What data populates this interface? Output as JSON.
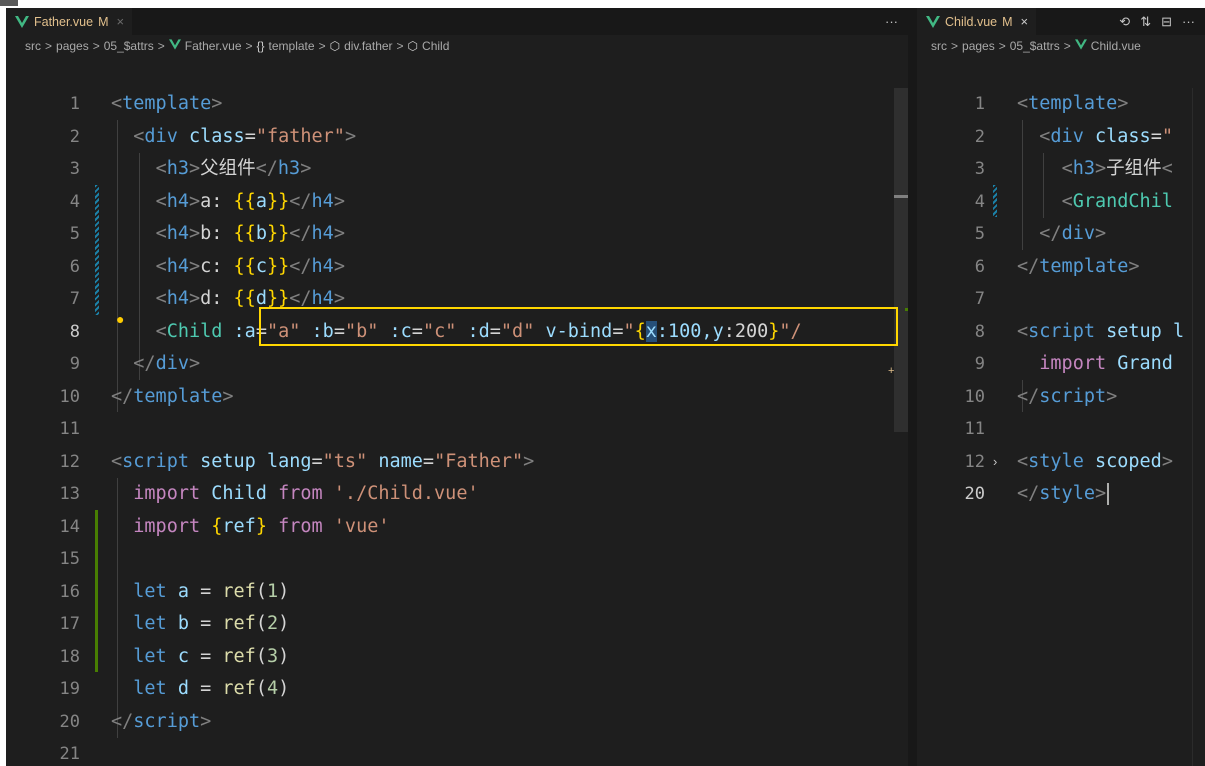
{
  "left_editor": {
    "tab": {
      "icon": "vue-icon",
      "name": "Father.vue",
      "status": "M",
      "close": "×"
    },
    "more_actions": "···",
    "breadcrumbs": [
      "src",
      "pages",
      "05_$attrs",
      "Father.vue",
      "template",
      "div.father",
      "Child"
    ],
    "breadcrumb_symbols": {
      "template": "{}",
      "div.father": "⬡",
      "Child": "⬡"
    },
    "lines": [
      {
        "n": "1",
        "segments": [
          [
            "pun",
            "<"
          ],
          [
            "tag",
            "template"
          ],
          [
            "pun",
            ">"
          ]
        ]
      },
      {
        "n": "2",
        "segments": [
          [
            "txt",
            "  "
          ],
          [
            "pun",
            "<"
          ],
          [
            "tag",
            "div"
          ],
          [
            "txt",
            " "
          ],
          [
            "attr",
            "class"
          ],
          [
            "txt",
            "="
          ],
          [
            "str",
            "\"father\""
          ],
          [
            "pun",
            ">"
          ]
        ]
      },
      {
        "n": "3",
        "segments": [
          [
            "txt",
            "    "
          ],
          [
            "pun",
            "<"
          ],
          [
            "tag",
            "h3"
          ],
          [
            "pun",
            ">"
          ],
          [
            "txt",
            "父组件"
          ],
          [
            "pun",
            "</"
          ],
          [
            "tag",
            "h3"
          ],
          [
            "pun",
            ">"
          ]
        ]
      },
      {
        "n": "4",
        "segments": [
          [
            "txt",
            "    "
          ],
          [
            "pun",
            "<"
          ],
          [
            "tag",
            "h4"
          ],
          [
            "pun",
            ">"
          ],
          [
            "txt",
            "a: "
          ],
          [
            "brace",
            "{{"
          ],
          [
            "var",
            "a"
          ],
          [
            "brace",
            "}}"
          ],
          [
            "pun",
            "</"
          ],
          [
            "tag",
            "h4"
          ],
          [
            "pun",
            ">"
          ]
        ]
      },
      {
        "n": "5",
        "segments": [
          [
            "txt",
            "    "
          ],
          [
            "pun",
            "<"
          ],
          [
            "tag",
            "h4"
          ],
          [
            "pun",
            ">"
          ],
          [
            "txt",
            "b: "
          ],
          [
            "brace",
            "{{"
          ],
          [
            "var",
            "b"
          ],
          [
            "brace",
            "}}"
          ],
          [
            "pun",
            "</"
          ],
          [
            "tag",
            "h4"
          ],
          [
            "pun",
            ">"
          ]
        ]
      },
      {
        "n": "6",
        "segments": [
          [
            "txt",
            "    "
          ],
          [
            "pun",
            "<"
          ],
          [
            "tag",
            "h4"
          ],
          [
            "pun",
            ">"
          ],
          [
            "txt",
            "c: "
          ],
          [
            "brace",
            "{{"
          ],
          [
            "var",
            "c"
          ],
          [
            "brace",
            "}}"
          ],
          [
            "pun",
            "</"
          ],
          [
            "tag",
            "h4"
          ],
          [
            "pun",
            ">"
          ]
        ]
      },
      {
        "n": "7",
        "segments": [
          [
            "txt",
            "    "
          ],
          [
            "pun",
            "<"
          ],
          [
            "tag",
            "h4"
          ],
          [
            "pun",
            ">"
          ],
          [
            "txt",
            "d: "
          ],
          [
            "brace",
            "{{"
          ],
          [
            "var",
            "d"
          ],
          [
            "brace",
            "}}"
          ],
          [
            "pun",
            "</"
          ],
          [
            "tag",
            "h4"
          ],
          [
            "pun",
            ">"
          ]
        ]
      },
      {
        "n": "8",
        "segments": [
          [
            "txt",
            "    "
          ],
          [
            "pun",
            "<"
          ],
          [
            "cls",
            "Child"
          ],
          [
            "txt",
            " "
          ],
          [
            "attr",
            ":a"
          ],
          [
            "txt",
            "="
          ],
          [
            "str",
            "\"a\""
          ],
          [
            "txt",
            " "
          ],
          [
            "attr",
            ":b"
          ],
          [
            "txt",
            "="
          ],
          [
            "str",
            "\"b\""
          ],
          [
            "txt",
            " "
          ],
          [
            "attr",
            ":c"
          ],
          [
            "txt",
            "="
          ],
          [
            "str",
            "\"c\""
          ],
          [
            "txt",
            " "
          ],
          [
            "attr",
            ":d"
          ],
          [
            "txt",
            "="
          ],
          [
            "str",
            "\"d\""
          ],
          [
            "txt",
            " "
          ],
          [
            "attr",
            "v-bind"
          ],
          [
            "txt",
            "="
          ],
          [
            "str",
            "\""
          ],
          [
            "brace",
            "{"
          ],
          [
            "sel",
            "x"
          ],
          [
            "var",
            ":100,"
          ],
          [
            "var",
            "y"
          ],
          [
            "txt",
            ":200"
          ],
          [
            "brace",
            "}"
          ],
          [
            "str",
            "\"/"
          ]
        ]
      },
      {
        "n": "9",
        "segments": [
          [
            "txt",
            "  "
          ],
          [
            "pun",
            "</"
          ],
          [
            "tag",
            "div"
          ],
          [
            "pun",
            ">"
          ]
        ]
      },
      {
        "n": "10",
        "segments": [
          [
            "pun",
            "</"
          ],
          [
            "tag",
            "template"
          ],
          [
            "pun",
            ">"
          ]
        ]
      },
      {
        "n": "11",
        "segments": []
      },
      {
        "n": "12",
        "segments": [
          [
            "pun",
            "<"
          ],
          [
            "tag",
            "script"
          ],
          [
            "txt",
            " "
          ],
          [
            "attr",
            "setup"
          ],
          [
            "txt",
            " "
          ],
          [
            "attr",
            "lang"
          ],
          [
            "txt",
            "="
          ],
          [
            "str",
            "\"ts\""
          ],
          [
            "txt",
            " "
          ],
          [
            "attr",
            "name"
          ],
          [
            "txt",
            "="
          ],
          [
            "str",
            "\"Father\""
          ],
          [
            "pun",
            ">"
          ]
        ]
      },
      {
        "n": "13",
        "segments": [
          [
            "txt",
            "  "
          ],
          [
            "imp",
            "import"
          ],
          [
            "txt",
            " "
          ],
          [
            "var",
            "Child"
          ],
          [
            "txt",
            " "
          ],
          [
            "imp",
            "from"
          ],
          [
            "txt",
            " "
          ],
          [
            "str",
            "'./Child.vue'"
          ]
        ]
      },
      {
        "n": "14",
        "segments": [
          [
            "txt",
            "  "
          ],
          [
            "imp",
            "import"
          ],
          [
            "txt",
            " "
          ],
          [
            "brace",
            "{"
          ],
          [
            "var",
            "ref"
          ],
          [
            "brace",
            "}"
          ],
          [
            "txt",
            " "
          ],
          [
            "imp",
            "from"
          ],
          [
            "txt",
            " "
          ],
          [
            "str",
            "'vue'"
          ]
        ]
      },
      {
        "n": "15",
        "segments": []
      },
      {
        "n": "16",
        "segments": [
          [
            "txt",
            "  "
          ],
          [
            "kw",
            "let"
          ],
          [
            "txt",
            " "
          ],
          [
            "var",
            "a"
          ],
          [
            "txt",
            " = "
          ],
          [
            "fn",
            "ref"
          ],
          [
            "txt",
            "("
          ],
          [
            "num",
            "1"
          ],
          [
            "txt",
            ")"
          ]
        ]
      },
      {
        "n": "17",
        "segments": [
          [
            "txt",
            "  "
          ],
          [
            "kw",
            "let"
          ],
          [
            "txt",
            " "
          ],
          [
            "var",
            "b"
          ],
          [
            "txt",
            " = "
          ],
          [
            "fn",
            "ref"
          ],
          [
            "txt",
            "("
          ],
          [
            "num",
            "2"
          ],
          [
            "txt",
            ")"
          ]
        ]
      },
      {
        "n": "18",
        "segments": [
          [
            "txt",
            "  "
          ],
          [
            "kw",
            "let"
          ],
          [
            "txt",
            " "
          ],
          [
            "var",
            "c"
          ],
          [
            "txt",
            " = "
          ],
          [
            "fn",
            "ref"
          ],
          [
            "txt",
            "("
          ],
          [
            "num",
            "3"
          ],
          [
            "txt",
            ")"
          ]
        ]
      },
      {
        "n": "19",
        "segments": [
          [
            "txt",
            "  "
          ],
          [
            "kw",
            "let"
          ],
          [
            "txt",
            " "
          ],
          [
            "var",
            "d"
          ],
          [
            "txt",
            " = "
          ],
          [
            "fn",
            "ref"
          ],
          [
            "txt",
            "("
          ],
          [
            "num",
            "4"
          ],
          [
            "txt",
            ")"
          ]
        ]
      },
      {
        "n": "20",
        "segments": [
          [
            "pun",
            "</"
          ],
          [
            "tag",
            "script"
          ],
          [
            "pun",
            ">"
          ]
        ]
      },
      {
        "n": "21",
        "segments": []
      }
    ],
    "active_line": "8"
  },
  "right_editor": {
    "tab": {
      "icon": "vue-icon",
      "name": "Child.vue",
      "status": "M",
      "close": "×"
    },
    "actions": [
      {
        "icon": "history-icon",
        "glyph": "⟲"
      },
      {
        "icon": "compare-changes-icon",
        "glyph": "⇅"
      },
      {
        "icon": "split-editor-icon",
        "glyph": "⊟"
      },
      {
        "icon": "more-actions-icon",
        "glyph": "···"
      }
    ],
    "breadcrumbs": [
      "src",
      "pages",
      "05_$attrs",
      "Child.vue"
    ],
    "lines": [
      {
        "n": "1",
        "segments": [
          [
            "pun",
            "<"
          ],
          [
            "tag",
            "template"
          ],
          [
            "pun",
            ">"
          ]
        ]
      },
      {
        "n": "2",
        "segments": [
          [
            "txt",
            "  "
          ],
          [
            "pun",
            "<"
          ],
          [
            "tag",
            "div"
          ],
          [
            "txt",
            " "
          ],
          [
            "attr",
            "class"
          ],
          [
            "txt",
            "="
          ],
          [
            "str",
            "\""
          ]
        ]
      },
      {
        "n": "3",
        "segments": [
          [
            "txt",
            "    "
          ],
          [
            "pun",
            "<"
          ],
          [
            "tag",
            "h3"
          ],
          [
            "pun",
            ">"
          ],
          [
            "txt",
            "子组件"
          ],
          [
            "pun",
            "<"
          ]
        ]
      },
      {
        "n": "4",
        "segments": [
          [
            "txt",
            "    "
          ],
          [
            "pun",
            "<"
          ],
          [
            "cls",
            "GrandChil"
          ]
        ]
      },
      {
        "n": "5",
        "segments": [
          [
            "txt",
            "  "
          ],
          [
            "pun",
            "</"
          ],
          [
            "tag",
            "div"
          ],
          [
            "pun",
            ">"
          ]
        ]
      },
      {
        "n": "6",
        "segments": [
          [
            "pun",
            "</"
          ],
          [
            "tag",
            "template"
          ],
          [
            "pun",
            ">"
          ]
        ]
      },
      {
        "n": "7",
        "segments": []
      },
      {
        "n": "8",
        "segments": [
          [
            "pun",
            "<"
          ],
          [
            "tag",
            "script"
          ],
          [
            "txt",
            " "
          ],
          [
            "attr",
            "setup"
          ],
          [
            "txt",
            " "
          ],
          [
            "attr",
            "l"
          ]
        ]
      },
      {
        "n": "9",
        "segments": [
          [
            "txt",
            "  "
          ],
          [
            "imp",
            "import"
          ],
          [
            "txt",
            " "
          ],
          [
            "var",
            "Grand"
          ]
        ]
      },
      {
        "n": "10",
        "segments": [
          [
            "pun",
            "</"
          ],
          [
            "tag",
            "script"
          ],
          [
            "pun",
            ">"
          ]
        ]
      },
      {
        "n": "11",
        "segments": []
      },
      {
        "n": "12",
        "segments": [
          [
            "pun",
            "<"
          ],
          [
            "tag",
            "style"
          ],
          [
            "txt",
            " "
          ],
          [
            "attr",
            "scoped"
          ],
          [
            "pun",
            ">"
          ]
        ]
      },
      {
        "n": "20",
        "segments": [
          [
            "pun",
            "</"
          ],
          [
            "tag",
            "style"
          ],
          [
            "pun",
            ">"
          ]
        ]
      }
    ],
    "fold_marker": "›",
    "active_line": "20"
  },
  "colors": {
    "editor_bg": "#1e1e1e",
    "highlight_box": "#ffd700",
    "modified_tab": "#e2c08d",
    "vue_green": "#41b883"
  }
}
